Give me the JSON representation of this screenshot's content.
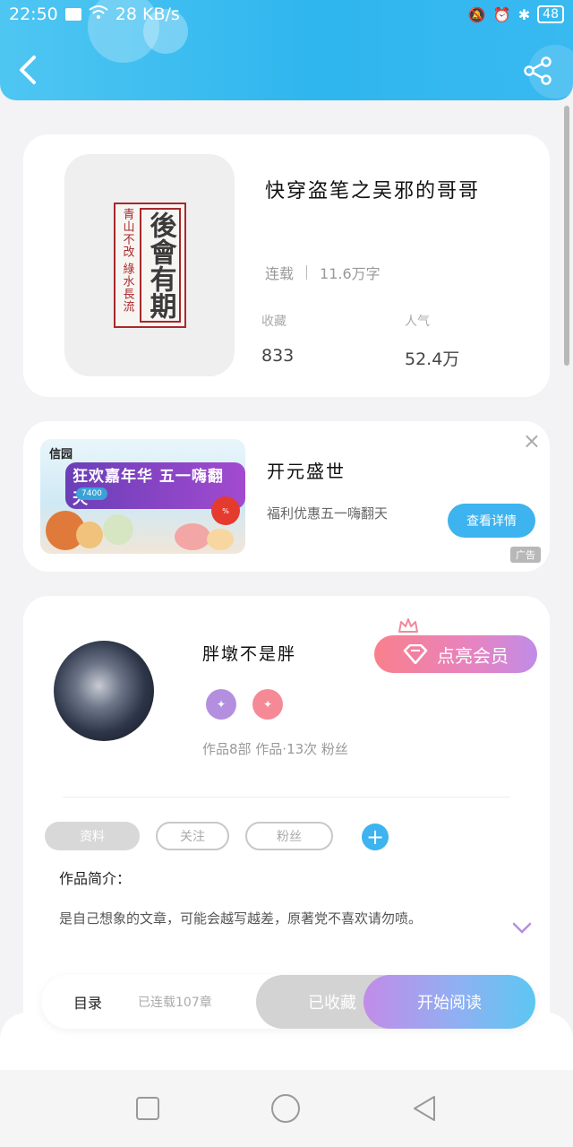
{
  "status_bar": {
    "time": "22:50",
    "speed": "28 KB/s",
    "battery": "48"
  },
  "book": {
    "title": "快穿盗笔之吴邪的哥哥",
    "status": "连载",
    "word_count": "11.6万字",
    "collect_label": "收藏",
    "collect_value": "833",
    "popularity_label": "人气",
    "popularity_value": "52.4万",
    "cover_small_text": "青山不改 綠水長流",
    "cover_big_text": "後會有期"
  },
  "ad": {
    "brand": "信园",
    "banner_text": "狂欢嘉年华 五一嗨翻天",
    "banner_sub": "7400",
    "title": "开元盛世",
    "description": "福利优惠五一嗨翻天",
    "button": "查看详情",
    "badge": "广告",
    "close": "×"
  },
  "author": {
    "name": "胖墩不是胖",
    "vip_button": "点亮会员",
    "stats": "作品8部 作品·13次 粉丝",
    "tag_1": "资料",
    "tag_2": "关注",
    "tag_3": "粉丝",
    "works_label": "作品简介：",
    "works_text": "是自己想象的文章，可能会越写越差，原著党不喜欢请勿喷。"
  },
  "actions": {
    "toc": "目录",
    "toc_count": "已连载107章",
    "collect": "已收藏",
    "read": "开始阅读"
  },
  "colors": {
    "header": "#2fb6ee",
    "accent_blue": "#3db3ef",
    "vip_pink": "#f9808c",
    "seal_red": "#a8282c"
  }
}
